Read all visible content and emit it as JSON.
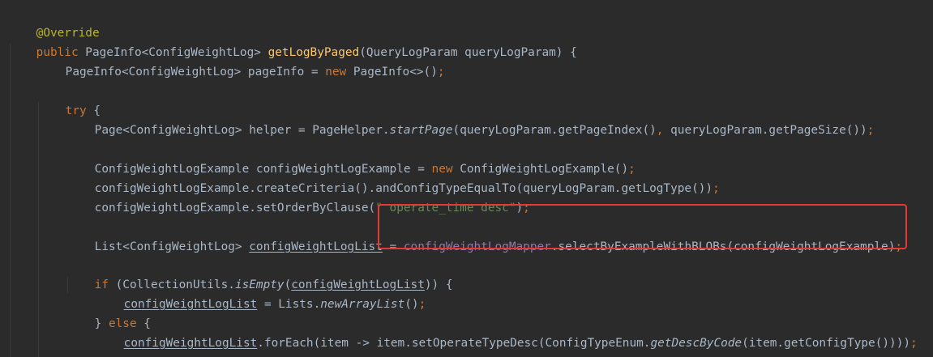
{
  "code": {
    "line1": {
      "annotation": "@Override"
    },
    "line2": {
      "kw_public": "public",
      "return_type": " PageInfo<ConfigWeightLog> ",
      "method_name": "getLogByPaged",
      "params": "(QueryLogParam queryLogParam) {"
    },
    "line3": {
      "decl": "PageInfo<ConfigWeightLog> pageInfo = ",
      "kw_new": "new",
      "rest": " PageInfo<>()",
      "semi": ";"
    },
    "line4": {
      "kw_try": "try",
      "rest": " {"
    },
    "line5": {
      "decl": "Page<ConfigWeightLog> helper = PageHelper.",
      "static_call": "startPage",
      "args": "(queryLogParam.getPageIndex()",
      "comma": ",",
      "args2": " queryLogParam.getPageSize())",
      "semi": ";"
    },
    "line6": {
      "decl": "ConfigWeightLogExample configWeightLogExample = ",
      "kw_new": "new",
      "rest": " ConfigWeightLogExample()",
      "semi": ";"
    },
    "line7": {
      "text": "configWeightLogExample.createCriteria().andConfigTypeEqualTo(queryLogParam.getLogType())",
      "semi": ";"
    },
    "line8": {
      "prefix": "configWeightLogExample.setOrderByClause(",
      "string": "\" operate_time desc\"",
      "suffix": ")",
      "semi": ";"
    },
    "line9": {
      "decl": "List<ConfigWeightLog> ",
      "var": "configWeightLogList",
      "eq": " = ",
      "field": "configWeightLogMapper",
      "call": ".selectByExampleWithBLOBs(configWeightLogExample)",
      "semi": ";"
    },
    "line10": {
      "kw_if": "if",
      "open": " (CollectionUtils.",
      "static_call": "isEmpty",
      "paren": "(",
      "var": "configWeightLogList",
      "close": ")) {"
    },
    "line11": {
      "var": "configWeightLogList",
      "eq": " = Lists.",
      "static_call": "newArrayList",
      "close": "()",
      "semi": ";"
    },
    "line12": {
      "open": "} ",
      "kw_else": "else",
      "rest": " {"
    },
    "line13": {
      "var": "configWeightLogList",
      "call": ".forEach(item -> item.setOperateTypeDesc(ConfigTypeEnum.",
      "static_call": "getDescByCode",
      "close": "(item.getConfigType())))",
      "semi": ";"
    },
    "line14": {
      "brace": "}"
    }
  },
  "highlight": {
    "color": "#e53935"
  },
  "colors": {
    "background": "#2b2b2b",
    "text": "#a9b7c6",
    "keyword": "#cc7832",
    "annotation": "#bbb529",
    "method_decl": "#ffc66d",
    "string": "#6a8759",
    "field": "#9876aa"
  }
}
